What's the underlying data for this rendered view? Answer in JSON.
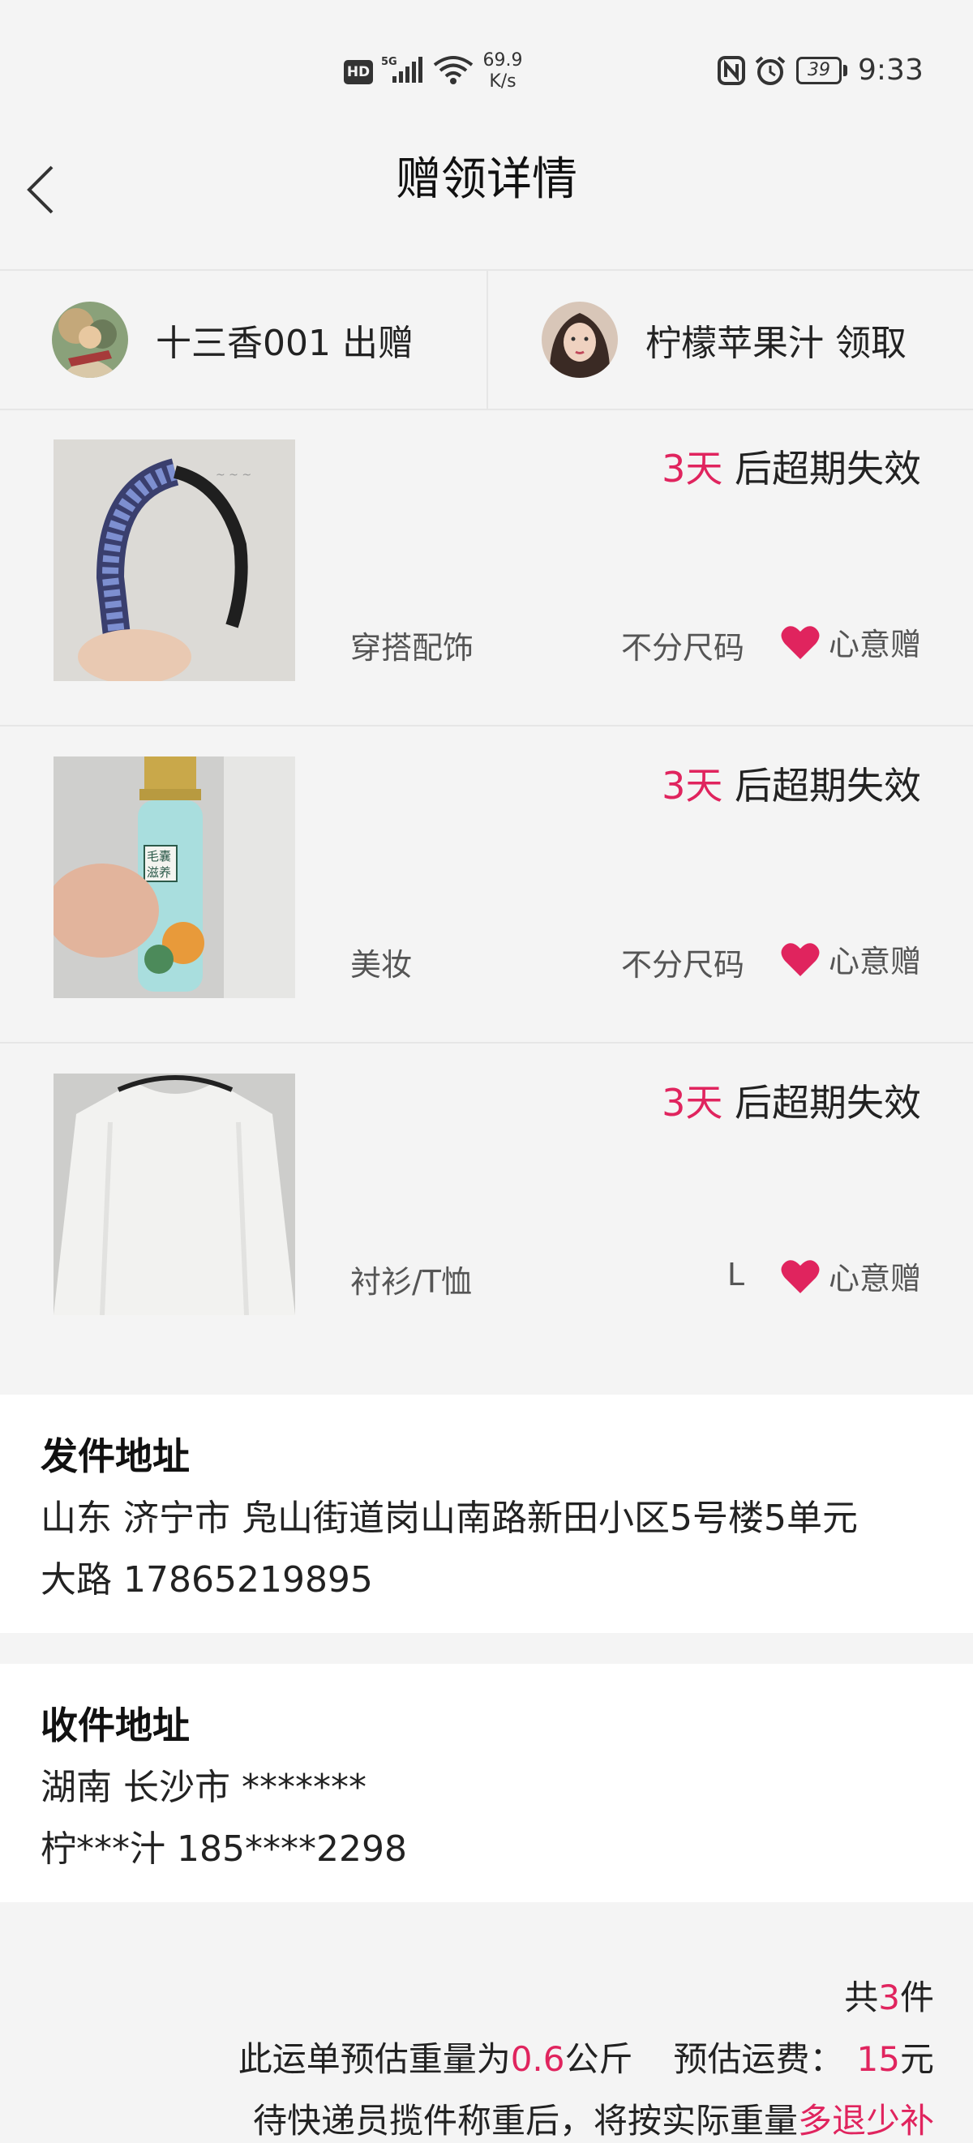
{
  "status_bar": {
    "hd": "HD",
    "network": "5G",
    "speed_value": "69.9",
    "speed_unit": "K/s",
    "battery": "39",
    "time": "9:33"
  },
  "header": {
    "title": "赠领详情",
    "back_icon": "chevron-left-icon"
  },
  "parties": {
    "giver": {
      "name": "十三香001",
      "action": "出赠"
    },
    "receiver": {
      "name": "柠檬苹果汁",
      "action": "领取"
    }
  },
  "items": [
    {
      "expire_num": "3天",
      "expire_text": " 后超期失效",
      "category": "穿搭配饰",
      "size": "不分尺码",
      "tag": "心意赠",
      "thumb": "headband"
    },
    {
      "expire_num": "3天",
      "expire_text": " 后超期失效",
      "category": "美妆",
      "size": "不分尺码",
      "tag": "心意赠",
      "thumb": "bottle"
    },
    {
      "expire_num": "3天",
      "expire_text": " 后超期失效",
      "category": "衬衫/T恤",
      "size": "L",
      "tag": "心意赠",
      "thumb": "shirt"
    }
  ],
  "sender_address": {
    "title": "发件地址",
    "line1": "山东 济宁市 凫山街道岗山南路新田小区5号楼5单元",
    "line2": "大路 17865219895"
  },
  "receiver_address": {
    "title": "收件地址",
    "line1": "湖南 长沙市 *******",
    "line2": "柠***汁 185****2298"
  },
  "summary": {
    "count_prefix": "共",
    "count": "3",
    "count_suffix": "件",
    "weight_prefix": "此运单预估重量为",
    "weight": "0.6",
    "weight_unit": "公斤",
    "fee_label": "预估运费：",
    "fee": "15",
    "fee_unit": "元",
    "note_prefix": "待快递员揽件称重后，将按实际重量",
    "note_highlight": "多退少补"
  },
  "colors": {
    "accent": "#e0245e",
    "background": "#f4f4f4",
    "card": "#ffffff"
  }
}
